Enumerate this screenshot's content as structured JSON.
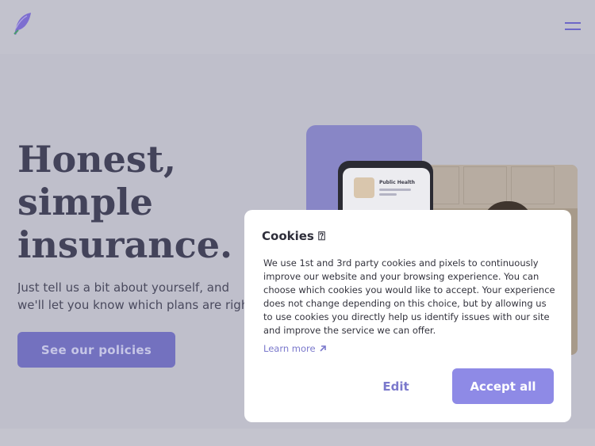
{
  "header": {
    "logo_icon": "feather-logo-icon",
    "menu_icon": "hamburger-menu-icon"
  },
  "hero": {
    "title": "Honest,\nsimple\ninsurance.",
    "subtitle": "Just tell us a bit about yourself, and we'll let you know which plans are right for you!",
    "cta_label": "See our policies"
  },
  "illustration": {
    "tablet_label": "Public Health"
  },
  "cookie_banner": {
    "title": "Cookies ⍰",
    "body": "We use 1st and 3rd party cookies and pixels to continuously improve our website and your browsing experience. You can choose which cookies you would like to accept. Your experience does not change depending on this choice, but by allowing us to use cookies you directly help us identify issues with our site and improve the service we can offer.",
    "learn_more_label": "Learn more",
    "learn_more_icon": "arrow-up-right-icon",
    "edit_label": "Edit",
    "accept_label": "Accept all"
  },
  "colors": {
    "accent": "#8e8ae6",
    "link": "#7b79cc",
    "heading": "#43435a",
    "overlay_background": "#bfbfcb"
  }
}
